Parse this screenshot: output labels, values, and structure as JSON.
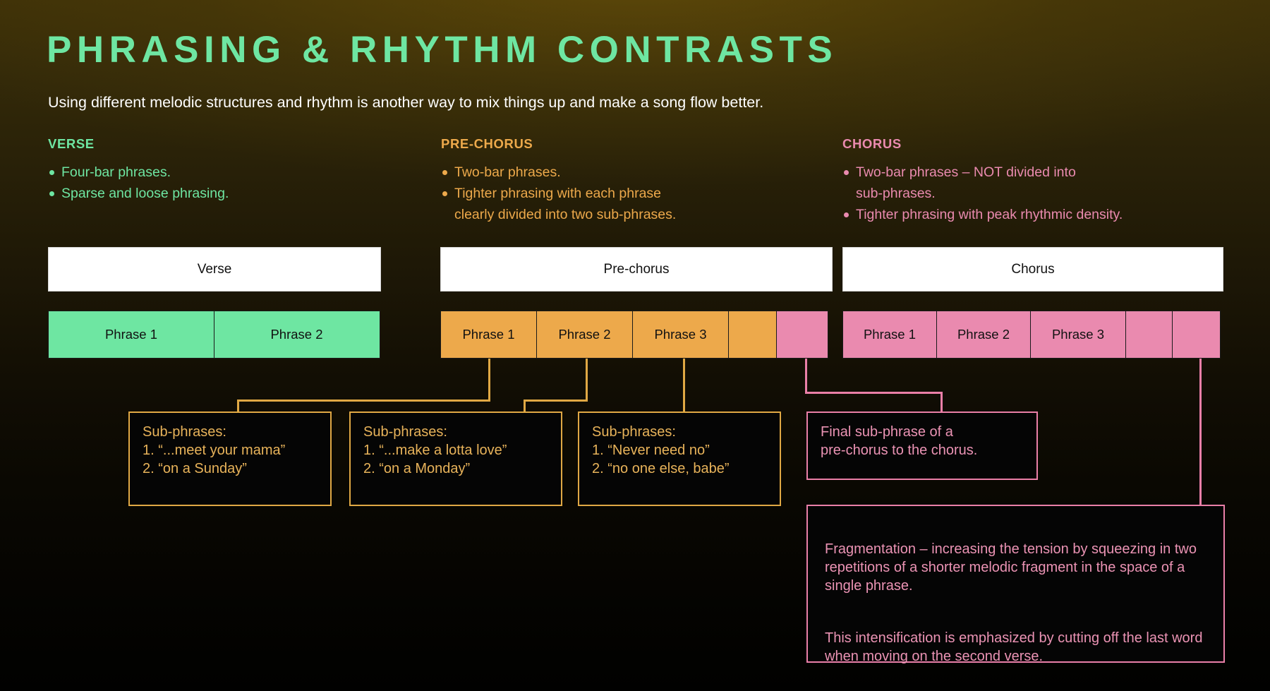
{
  "header": {
    "title": "PHRASING & RHYTHM CONTRASTS",
    "subtitle": "Using different melodic structures and rhythm is another way to mix things up and make a song flow better."
  },
  "colors": {
    "green": "#6ee6a2",
    "orange": "#eda94b",
    "pink": "#ea8aaf",
    "callout_orange_border": "#e0a844",
    "callout_pink_border": "#ea7fa8",
    "title_green": "#6ee6a2",
    "background_top": "#3d3008",
    "background_bottom": "#010100"
  },
  "columns": [
    {
      "heading": "VERSE",
      "bullets": [
        "Four-bar phrases.",
        "Sparse and loose phrasing."
      ]
    },
    {
      "heading": "PRE-CHORUS",
      "bullets": [
        "Two-bar phrases.",
        "Tighter phrasing with each phrase\nclearly divided into two sub-phrases."
      ]
    },
    {
      "heading": "CHORUS",
      "bullets": [
        "Two-bar phrases – NOT divided into\nsub-phrases.",
        "Tighter phrasing with peak rhythmic density."
      ]
    }
  ],
  "timeline": {
    "sections": [
      {
        "label": "Verse"
      },
      {
        "label": "Pre-chorus"
      },
      {
        "label": "Chorus"
      }
    ],
    "verse_phrases": [
      {
        "label": "Phrase 1"
      },
      {
        "label": "Phrase 2"
      }
    ],
    "prechorus_phrases": [
      {
        "label": "Phrase 1"
      },
      {
        "label": "Phrase 2"
      },
      {
        "label": "Phrase 3"
      },
      {
        "label": ""
      },
      {
        "label": ""
      }
    ],
    "chorus_phrases": [
      {
        "label": "Phrase 1"
      },
      {
        "label": "Phrase 2"
      },
      {
        "label": "Phrase 3"
      },
      {
        "label": ""
      },
      {
        "label": ""
      }
    ]
  },
  "callouts": {
    "sub1": "Sub-phrases:\n1. “...meet your mama”\n2. “on a Sunday”",
    "sub2": "Sub-phrases:\n1. “...make a lotta love”\n2. “on a Monday”",
    "sub3": "Sub-phrases:\n1. “Never need no”\n2. “no one else, babe”",
    "final": "Final sub-phrase of a\npre-chorus to the chorus.",
    "fragmentation_p1": "Fragmentation – increasing the tension by squeezing in two repetitions of a shorter melodic fragment in the space of a single phrase.",
    "fragmentation_p2": "This intensification is emphasized by cutting off the last word when moving on the second verse."
  }
}
